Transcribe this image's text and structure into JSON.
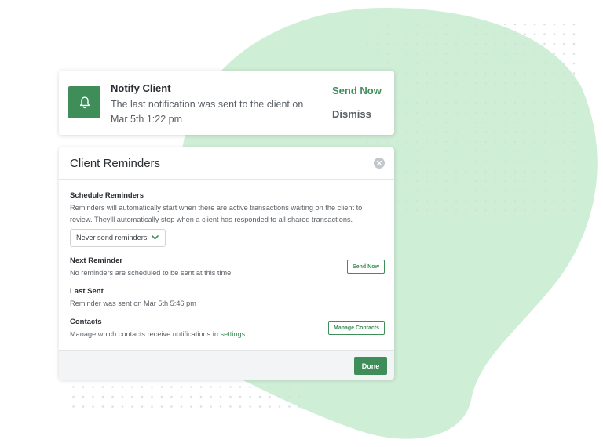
{
  "colors": {
    "accent": "#3f8e5a",
    "blob": "#cfeed6",
    "dots": "#d8dcdf"
  },
  "notify": {
    "icon": "bell-icon",
    "title": "Notify Client",
    "message": "The last notification was sent to the client on Mar 5th 1:22 pm",
    "send_now": "Send Now",
    "dismiss": "Dismiss"
  },
  "reminders": {
    "title": "Client Reminders",
    "close_icon": "close-icon",
    "schedule": {
      "heading": "Schedule Reminders",
      "text": "Reminders will automatically start when there are active transactions waiting on the client to review. They'll automatically stop when a client has responded to all shared transactions.",
      "select_value": "Never send reminders",
      "select_icon": "chevron-down-icon"
    },
    "next": {
      "heading": "Next Reminder",
      "text": "No reminders are scheduled to be sent at this time",
      "button": "Send Now"
    },
    "last_sent": {
      "heading": "Last Sent",
      "text": "Reminder was sent on Mar 5th 5:46 pm"
    },
    "contacts": {
      "heading": "Contacts",
      "text_before": "Manage which contacts receive notifications in ",
      "link": "settings",
      "text_after": ".",
      "button": "Manage Contacts"
    },
    "done": "Done"
  }
}
